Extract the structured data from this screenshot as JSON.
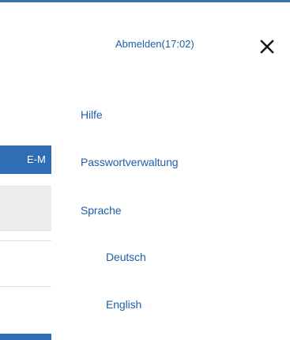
{
  "header": {
    "logout_label": "Abmelden",
    "session_timer": "(17:02)",
    "close_icon": "close-x-icon"
  },
  "menu": {
    "help": "Hilfe",
    "password_management": "Passwortverwaltung",
    "language": "Sprache",
    "languages": [
      {
        "label": "Deutsch"
      },
      {
        "label": "English"
      }
    ]
  },
  "background": {
    "tab_fragment": "E-M"
  },
  "colors": {
    "link": "#1f5fa6",
    "accent": "#2f6db5",
    "top_rule": "#3f72ab",
    "field_bg": "#eeeeee"
  }
}
